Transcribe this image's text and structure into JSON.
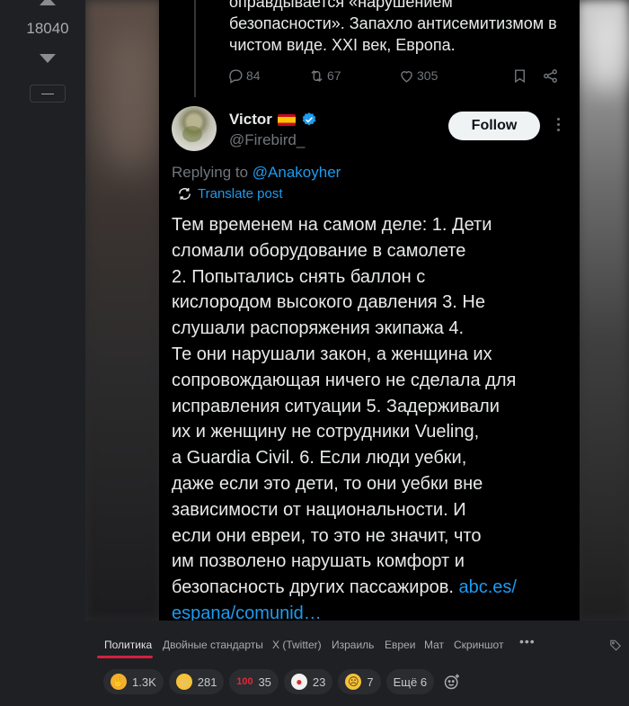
{
  "vote": {
    "count": "18040",
    "collapse_label": "—"
  },
  "tweet": {
    "previous_text": "оправдывается «нарушением безопасности». Запахло антисемитизмом в чистом виде. XXI век, Европа.",
    "actions": {
      "replies": "84",
      "retweets": "67",
      "likes": "305"
    },
    "author": {
      "name": "Victor",
      "handle": "@Firebird_",
      "flag": "spain-flag"
    },
    "follow_label": "Follow",
    "replying_prefix": "Replying to",
    "replying_to": "@Anakoyher",
    "translate_label": "Translate post",
    "body": "Тем временем на самом деле: 1. Дети\nсломали оборудование в самолете\n2. Попытались снять баллон с\nкислородом высокого давления 3. Не\nслушали распоряжения экипажа 4.\nТе они нарушали закон, а женщина их\nсопровождающая ничего не сделала для\nисправления ситуации 5. Задерживали\nих и женщину не сотрудники Vueling,\nа Guardia Civil. 6. Если люди уебки,\nдаже если это дети, то они уебки вне\nзависимости от национальности. И\nесли они евреи, то это не значит, что\nим позволено нарушать комфорт и\nбезопасность других пассажиров. ",
    "link_part1": "abc.es/",
    "link_part2": "espana/comunid…"
  },
  "tags": {
    "items": [
      "Политика",
      "Двойные стандарты",
      "X (Twitter)",
      "Израиль",
      "Евреи",
      "Мат",
      "Скриншот"
    ],
    "more_label": "•••"
  },
  "reactions": [
    {
      "icon": "clap-icon",
      "count": "1.3K"
    },
    {
      "icon": "laughing-face-icon",
      "count": "281"
    },
    {
      "icon": "hundred-icon",
      "count": "35"
    },
    {
      "icon": "clown-face-icon",
      "count": "23"
    },
    {
      "icon": "grimacing-face-icon",
      "count": "7"
    }
  ],
  "reactions_more_label": "Ещё 6",
  "colors": {
    "accent_link": "#1d9bf0",
    "tag_underline": "#d6213f",
    "page_bg": "#1f2023"
  }
}
